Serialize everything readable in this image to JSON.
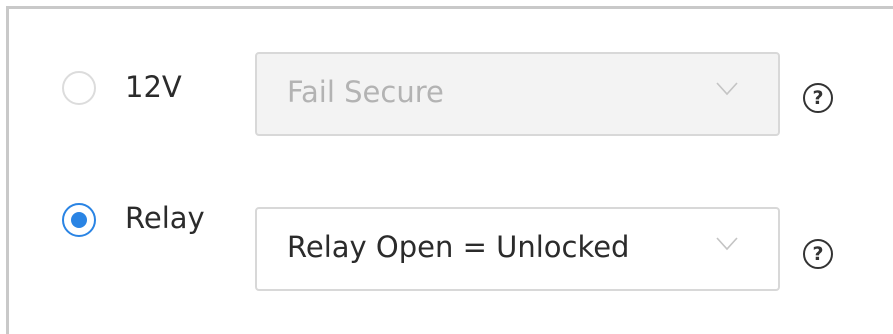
{
  "options": [
    {
      "label": "12V",
      "selected": false,
      "select_value": "Fail Secure",
      "select_disabled": true,
      "help_glyph": "?"
    },
    {
      "label": "Relay",
      "selected": true,
      "select_value": "Relay Open = Unlocked",
      "select_disabled": false,
      "help_glyph": "?"
    }
  ],
  "icons": {
    "chevron": "chevron-down-icon",
    "help": "help-circle-icon"
  },
  "colors": {
    "accent": "#2a84e4",
    "disabled_bg": "#f3f3f3",
    "disabled_text": "#b3b3b3",
    "border": "#d8d8d8"
  }
}
